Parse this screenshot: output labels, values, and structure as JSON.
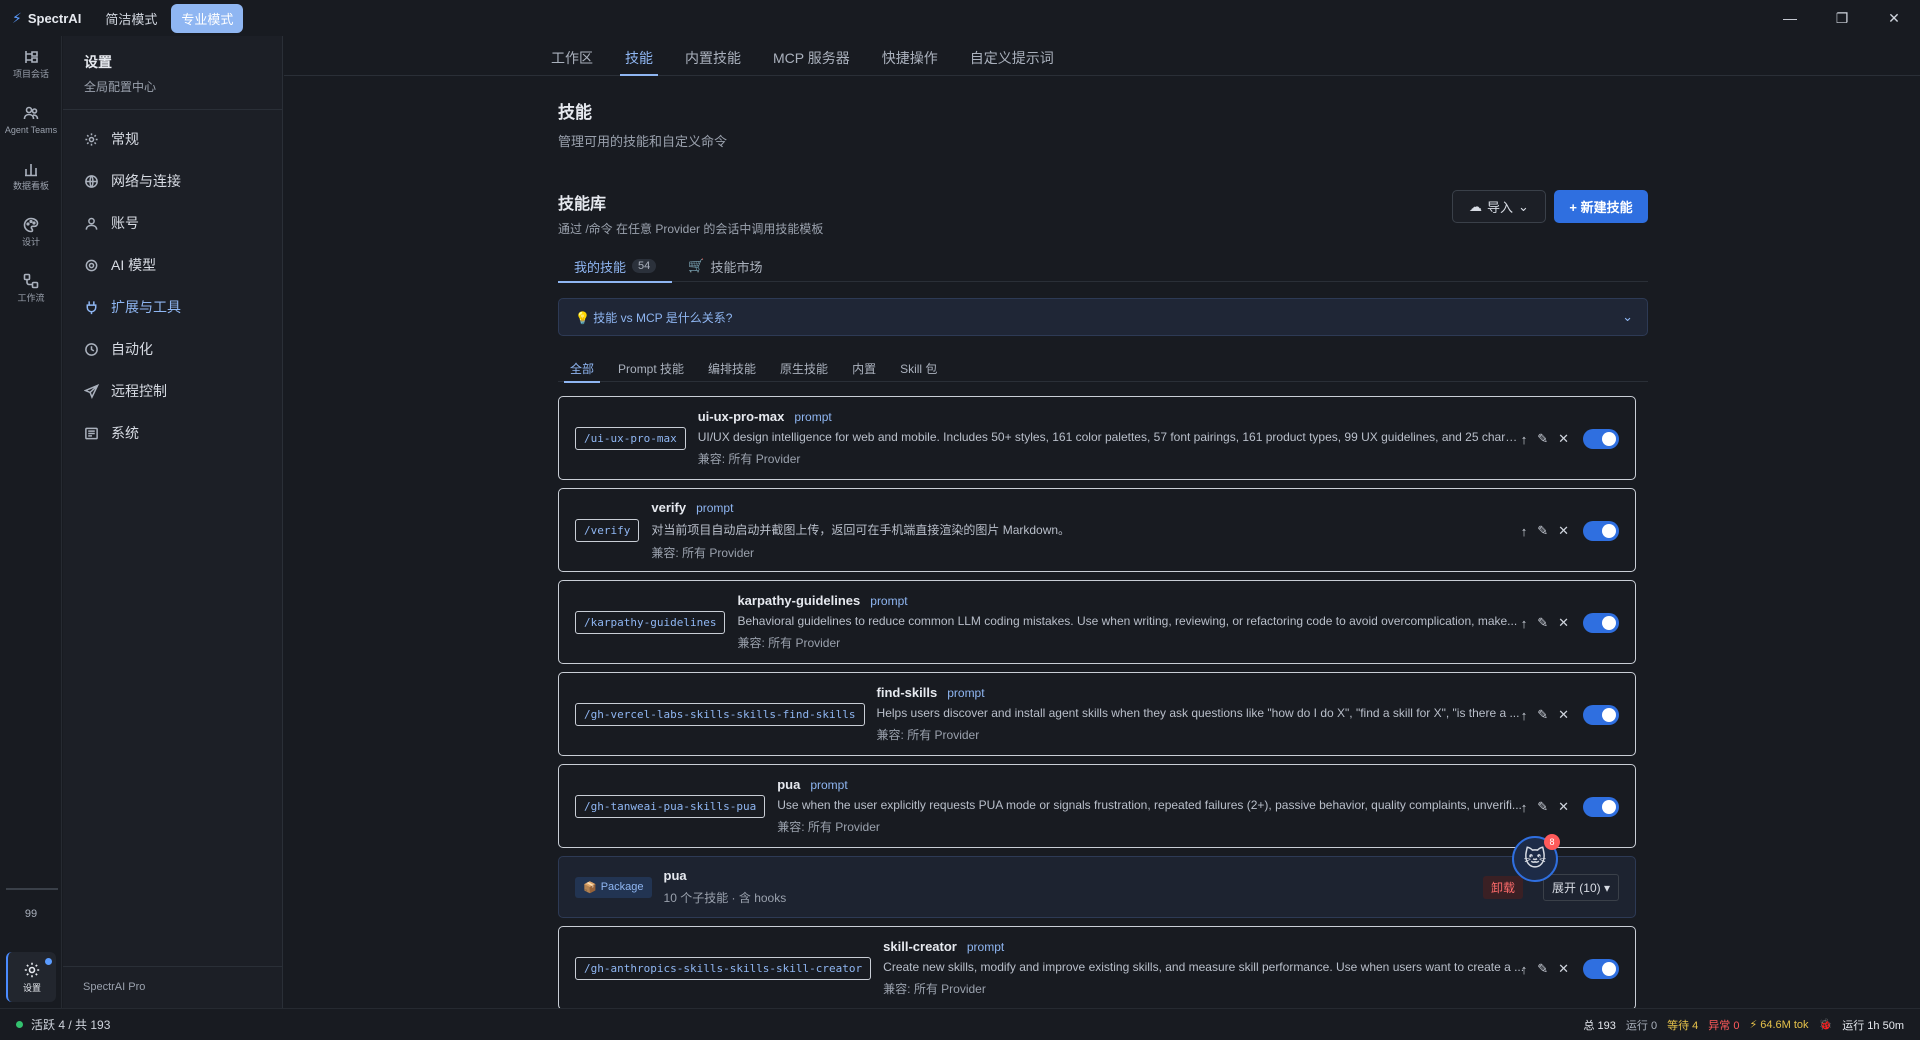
{
  "app": {
    "name": "SpectrAI",
    "mode_simple": "简洁模式",
    "mode_pro": "专业模式"
  },
  "window": {
    "minimize": "—",
    "restore": "❐",
    "close": "✕"
  },
  "rail": {
    "items": [
      {
        "icon": "project-session-icon",
        "label": "项目会话"
      },
      {
        "icon": "agent-teams-icon",
        "label": "Agent Teams"
      },
      {
        "icon": "dashboard-icon",
        "label": "数据看板"
      },
      {
        "icon": "design-icon",
        "label": "设计"
      },
      {
        "icon": "workflow-icon",
        "label": "工作流"
      }
    ],
    "count": "99",
    "settings_label": "设置"
  },
  "sidebar": {
    "title": "设置",
    "subtitle": "全局配置中心",
    "items": [
      {
        "label": "常规",
        "icon": "gear-icon"
      },
      {
        "label": "网络与连接",
        "icon": "globe-icon"
      },
      {
        "label": "账号",
        "icon": "user-icon"
      },
      {
        "label": "AI 模型",
        "icon": "cog-icon"
      },
      {
        "label": "扩展与工具",
        "icon": "plug-icon"
      },
      {
        "label": "自动化",
        "icon": "clock-icon"
      },
      {
        "label": "远程控制",
        "icon": "send-icon"
      },
      {
        "label": "系统",
        "icon": "system-icon"
      }
    ],
    "footer": "SpectrAI Pro"
  },
  "tabs": [
    "工作区",
    "技能",
    "内置技能",
    "MCP 服务器",
    "快捷操作",
    "自定义提示词"
  ],
  "page": {
    "title": "技能",
    "subtitle": "管理可用的技能和自定义命令",
    "library_title": "技能库",
    "library_subtitle": "通过 /命令 在任意 Provider 的会话中调用技能模板",
    "import_label": "导入",
    "new_label": "+ 新建技能",
    "subtab_mine": "我的技能",
    "subtab_mine_count": "54",
    "subtab_market": "技能市场",
    "info": "💡 技能 vs MCP 是什么关系?",
    "filters": [
      "全部",
      "Prompt 技能",
      "编排技能",
      "原生技能",
      "内置",
      "Skill 包"
    ]
  },
  "skills": [
    {
      "cmd": "/ui-ux-pro-max",
      "name": "ui-ux-pro-max",
      "tag": "prompt",
      "desc": "UI/UX design intelligence for web and mobile. Includes 50+ styles, 161 color palettes, 57 font pairings, 161 product types, 99 UX guidelines, and 25 chart ...",
      "compat": "兼容:  所有 Provider"
    },
    {
      "cmd": "/verify",
      "name": "verify",
      "tag": "prompt",
      "desc": "对当前项目自动启动并截图上传，返回可在手机端直接渲染的图片 Markdown。",
      "compat": "兼容:  所有 Provider"
    },
    {
      "cmd": "/karpathy-guidelines",
      "name": "karpathy-guidelines",
      "tag": "prompt",
      "desc": "Behavioral guidelines to reduce common LLM coding mistakes. Use when writing, reviewing, or refactoring code to avoid overcomplication, make...",
      "compat": "兼容:  所有 Provider"
    },
    {
      "cmd": "/gh-vercel-labs-skills-skills-find-skills",
      "name": "find-skills",
      "tag": "prompt",
      "desc": "Helps users discover and install agent skills when they ask questions like \"how do I do X\", \"find a skill for X\", \"is there a ...",
      "compat": "兼容:  所有 Provider"
    },
    {
      "cmd": "/gh-tanweai-pua-skills-pua",
      "name": "pua",
      "tag": "prompt",
      "desc": "Use when the user explicitly requests PUA mode or signals frustration, repeated failures (2+), passive behavior, quality complaints, unverifi...",
      "compat": "兼容:  所有 Provider"
    }
  ],
  "package": {
    "badge": "Package",
    "name": "pua",
    "sub": "10 个子技能 · 含 hooks",
    "uninstall": "卸载",
    "expand": "展开 (10) ▾"
  },
  "skill_after": {
    "cmd": "/gh-anthropics-skills-skills-skill-creator",
    "name": "skill-creator",
    "tag": "prompt",
    "desc": "Create new skills, modify and improve existing skills, and measure skill performance. Use when users want to create a ...",
    "compat": "兼容:  所有 Provider"
  },
  "float_badge": "8",
  "status": {
    "active": "活跃 4 / 共 193",
    "total": "总 193",
    "running": "运行 0",
    "waiting": "等待 4",
    "errors": "异常 0",
    "tokens": "⚡ 64.6M tok",
    "uptime": "运行 1h 50m"
  },
  "colors": {
    "accent": "#8fb6f2",
    "primary_button": "#2f6fe0",
    "danger": "#ff5a5a",
    "success": "#33c26f"
  }
}
